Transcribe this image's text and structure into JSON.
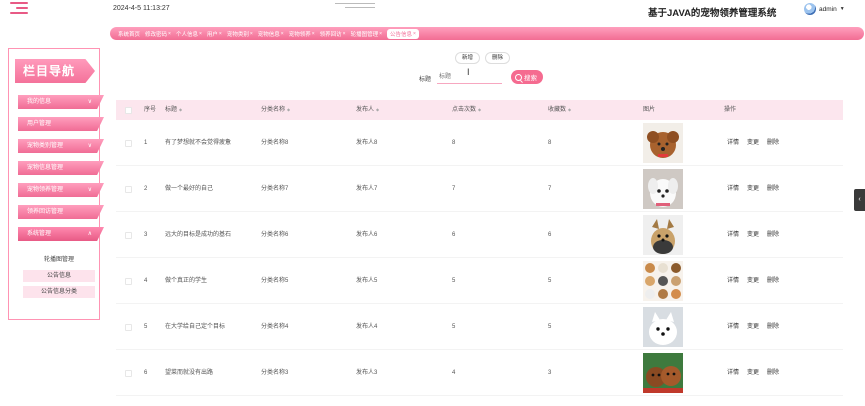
{
  "header": {
    "datetime": "2024-4-5 11:13:27",
    "title": "基于JAVA的宠物领养管理系统",
    "username": "admin"
  },
  "tabs": [
    {
      "label": "系统首页",
      "closable": false
    },
    {
      "label": "修改密码",
      "closable": true
    },
    {
      "label": "个人信息",
      "closable": true
    },
    {
      "label": "用户",
      "closable": true
    },
    {
      "label": "宠物类别",
      "closable": true
    },
    {
      "label": "宠物信息",
      "closable": true
    },
    {
      "label": "宠物领养",
      "closable": true
    },
    {
      "label": "领养回访",
      "closable": true
    },
    {
      "label": "轮播图管理",
      "closable": true
    },
    {
      "label": "公告信息",
      "closable": true
    }
  ],
  "sidebar": {
    "heading": "栏目导航",
    "items": [
      {
        "label": "我的信息",
        "arrow": "∨"
      },
      {
        "label": "用户管理",
        "arrow": ""
      },
      {
        "label": "宠物类别管理",
        "arrow": "∨"
      },
      {
        "label": "宠物信息管理",
        "arrow": ""
      },
      {
        "label": "宠物领养管理",
        "arrow": "∨"
      },
      {
        "label": "领养回访管理",
        "arrow": ""
      },
      {
        "label": "系统管理",
        "arrow": "∧"
      }
    ],
    "subitems": [
      "轮播图管理",
      "公告信息",
      "公告信息分类"
    ]
  },
  "toolbar": {
    "add_label": "新增",
    "delete_label": "删除",
    "search_label": "标题",
    "search_placeholder": "标题",
    "search_button": "搜索"
  },
  "table": {
    "headers": {
      "index": "序号",
      "title": "标题",
      "category": "分类名称",
      "publisher": "发布人",
      "clicks": "点击次数",
      "favorites": "收藏数",
      "image": "图片",
      "actions": "操作"
    },
    "action_labels": {
      "detail": "详情",
      "edit": "变更",
      "delete": "删除"
    },
    "rows": [
      {
        "index": "1",
        "title": "有了梦想就不会觉得疲惫",
        "category": "分类名称8",
        "publisher": "发布人8",
        "clicks": "8",
        "favorites": "8",
        "image": "brown-poodle-photo"
      },
      {
        "index": "2",
        "title": "做一个最好的自己",
        "category": "分类名称7",
        "publisher": "发布人7",
        "clicks": "7",
        "favorites": "7",
        "image": "white-puppy-photo"
      },
      {
        "index": "3",
        "title": "远大的目标是成功的基石",
        "category": "分类名称6",
        "publisher": "发布人6",
        "clicks": "6",
        "favorites": "6",
        "image": "yorkie-photo"
      },
      {
        "index": "4",
        "title": "做个真正的学生",
        "category": "分类名称5",
        "publisher": "发布人5",
        "clicks": "5",
        "favorites": "5",
        "image": "dog-collage-photo"
      },
      {
        "index": "5",
        "title": "在大学给自己定个目标",
        "category": "分类名称4",
        "publisher": "发布人4",
        "clicks": "5",
        "favorites": "5",
        "image": "samoyed-photo"
      },
      {
        "index": "6",
        "title": "望菜而就没有出路",
        "category": "分类名称3",
        "publisher": "发布人3",
        "clicks": "4",
        "favorites": "3",
        "image": "toy-poodles-photo"
      }
    ]
  },
  "colors": {
    "accent": "#f56b90",
    "accent_light": "#ff9fbd",
    "header_row": "#fce6ee"
  }
}
